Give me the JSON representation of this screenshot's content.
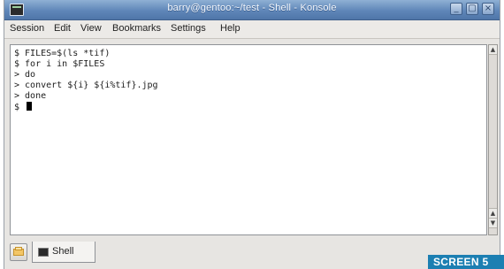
{
  "window": {
    "title": "barry@gentoo:~/test - Shell - Konsole",
    "buttons": {
      "minimize": "_",
      "maximize": "▢",
      "close": "×"
    }
  },
  "menu": [
    "Session",
    "Edit",
    "View",
    "Bookmarks",
    "Settings",
    "Help"
  ],
  "terminal": {
    "lines": [
      "$ FILES=$(ls *tif)",
      "$ for i in $FILES",
      "> do",
      "> convert ${i} ${i%tif}.jpg",
      "> done",
      "$ "
    ]
  },
  "tabs": [
    {
      "label": "Shell"
    }
  ],
  "watermark": "SCREEN 5",
  "colors": {
    "titlebar": "#5f86b8",
    "terminal_bg": "#ffffff",
    "watermark_bg": "#1c7fb2"
  },
  "icons": {
    "window_icon": "terminal-icon",
    "new_tab": "new-session-icon",
    "tab_icon": "shell-icon"
  }
}
